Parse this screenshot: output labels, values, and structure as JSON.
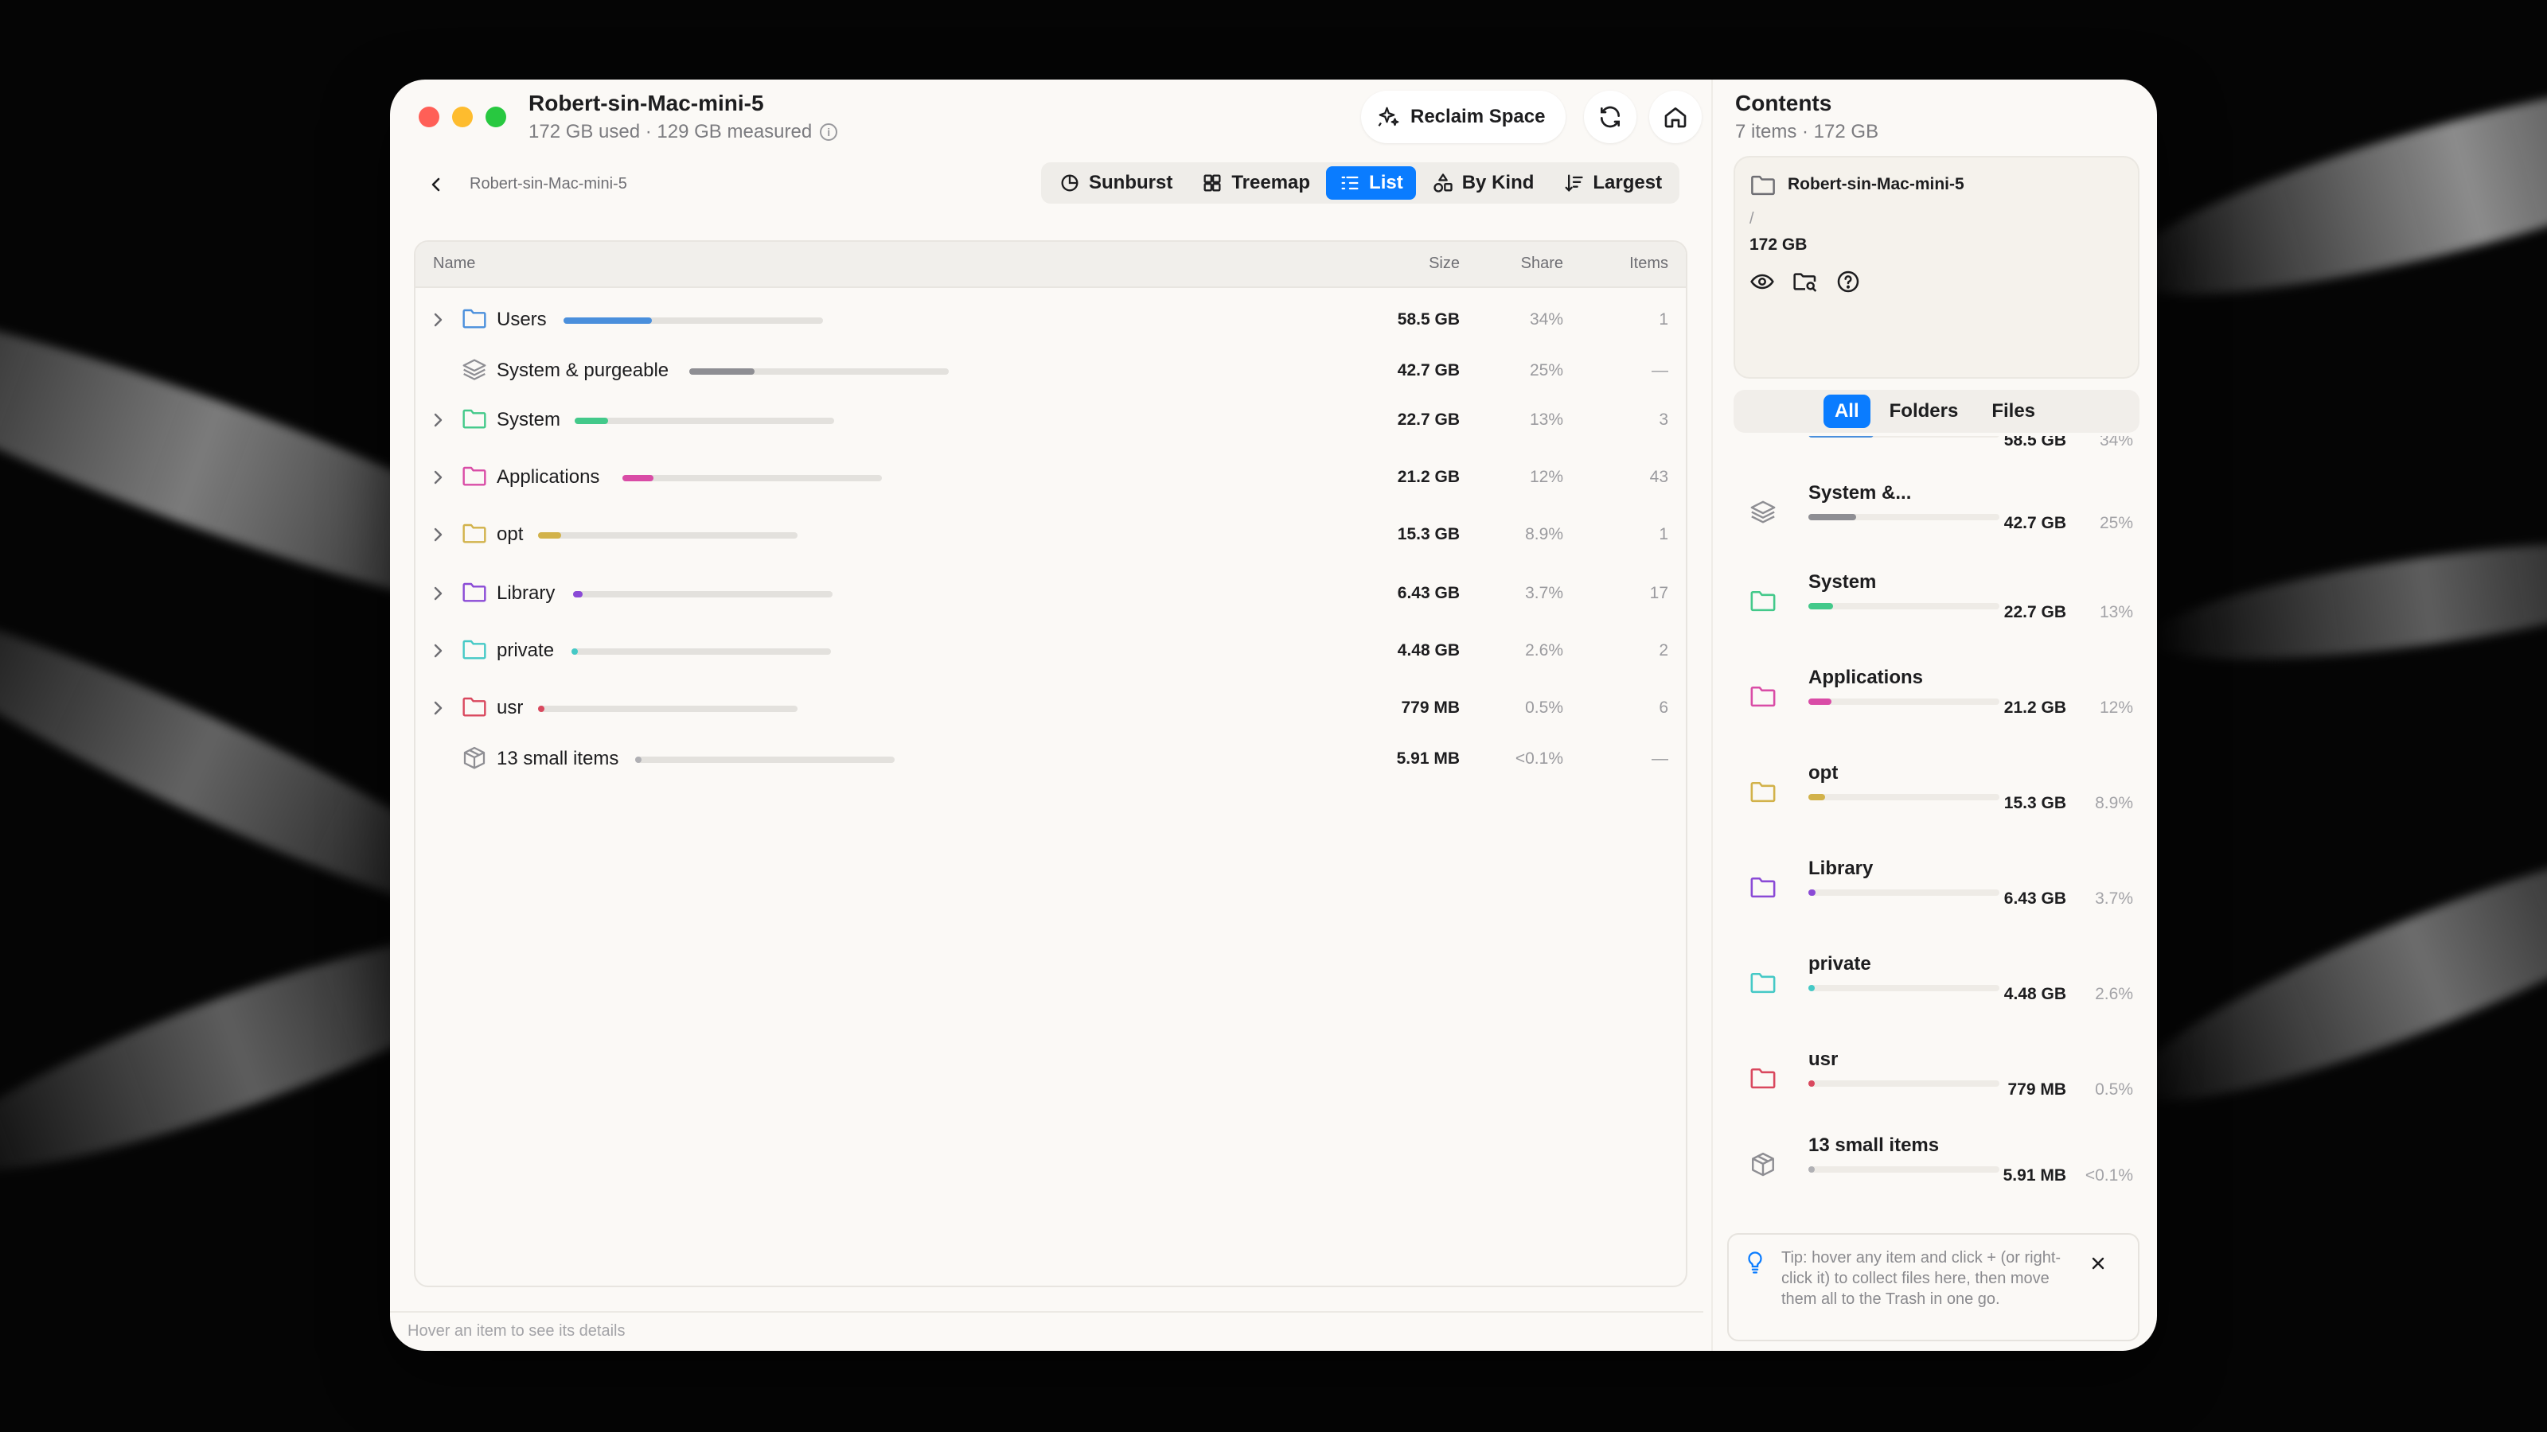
{
  "window": {
    "title": "Robert-sin-Mac-mini-5",
    "subtitle": "172 GB used · 129 GB measured",
    "reclaim_label": "Reclaim Space"
  },
  "breadcrumb": "Robert-sin-Mac-mini-5",
  "views": [
    {
      "label": "Sunburst",
      "icon": "sunburst-icon",
      "active": false
    },
    {
      "label": "Treemap",
      "icon": "treemap-icon",
      "active": false
    },
    {
      "label": "List",
      "icon": "list-icon",
      "active": true
    },
    {
      "label": "By Kind",
      "icon": "by-kind-icon",
      "active": false
    },
    {
      "label": "Largest",
      "icon": "sort-largest-icon",
      "active": false
    }
  ],
  "table": {
    "columns": {
      "name": "Name",
      "size": "Size",
      "share": "Share",
      "items": "Items"
    },
    "rows": [
      {
        "name": "Users",
        "size": "58.5 GB",
        "share": "34%",
        "items": "1",
        "expandable": true,
        "icon": "folder-icon",
        "color": "#4a8fdc",
        "fraction": 0.34
      },
      {
        "name": "System & purgeable",
        "size": "42.7 GB",
        "share": "25%",
        "items": "—",
        "expandable": false,
        "icon": "layers-icon",
        "color": "#8e8e93",
        "fraction": 0.25
      },
      {
        "name": "System",
        "size": "22.7 GB",
        "share": "13%",
        "items": "3",
        "expandable": true,
        "icon": "folder-icon",
        "color": "#43c98a",
        "fraction": 0.13
      },
      {
        "name": "Applications",
        "size": "21.2 GB",
        "share": "12%",
        "items": "43",
        "expandable": true,
        "icon": "folder-icon",
        "color": "#d94ca6",
        "fraction": 0.12
      },
      {
        "name": "opt",
        "size": "15.3 GB",
        "share": "8.9%",
        "items": "1",
        "expandable": true,
        "icon": "folder-icon",
        "color": "#d2b24a",
        "fraction": 0.089
      },
      {
        "name": "Library",
        "size": "6.43 GB",
        "share": "3.7%",
        "items": "17",
        "expandable": true,
        "icon": "folder-icon",
        "color": "#8a4ad6",
        "fraction": 0.037
      },
      {
        "name": "private",
        "size": "4.48 GB",
        "share": "2.6%",
        "items": "2",
        "expandable": true,
        "icon": "folder-icon",
        "color": "#45c9c6",
        "fraction": 0.026
      },
      {
        "name": "usr",
        "size": "779 MB",
        "share": "0.5%",
        "items": "6",
        "expandable": true,
        "icon": "folder-icon",
        "color": "#d9485e",
        "fraction": 0.005
      },
      {
        "name": "13 small items",
        "size": "5.91 MB",
        "share": "<0.1%",
        "items": "—",
        "expandable": false,
        "icon": "cube-icon",
        "color": "#b0b0b4",
        "fraction": 0.001
      }
    ]
  },
  "status": "Hover an item to see its details",
  "contents": {
    "title": "Contents",
    "subtitle": "7 items · 172 GB",
    "selected": {
      "name": "Robert-sin-Mac-mini-5",
      "path": "/",
      "size": "172 GB"
    },
    "filters": [
      {
        "label": "All",
        "active": true
      },
      {
        "label": "Folders",
        "active": false
      },
      {
        "label": "Files",
        "active": false
      }
    ],
    "partial_row": {
      "size": "58.5 GB",
      "share": "34%",
      "color": "#4a8fdc",
      "fraction": 0.34
    },
    "items": [
      {
        "name": "System &...",
        "size": "42.7 GB",
        "share": "25%",
        "icon": "layers-icon",
        "color": "#8e8e93",
        "fraction": 0.25
      },
      {
        "name": "System",
        "size": "22.7 GB",
        "share": "13%",
        "icon": "folder-icon",
        "color": "#43c98a",
        "fraction": 0.13
      },
      {
        "name": "Applications",
        "size": "21.2 GB",
        "share": "12%",
        "icon": "folder-icon",
        "color": "#d94ca6",
        "fraction": 0.12
      },
      {
        "name": "opt",
        "size": "15.3 GB",
        "share": "8.9%",
        "icon": "folder-icon",
        "color": "#d2b24a",
        "fraction": 0.089
      },
      {
        "name": "Library",
        "size": "6.43 GB",
        "share": "3.7%",
        "icon": "folder-icon",
        "color": "#8a4ad6",
        "fraction": 0.037
      },
      {
        "name": "private",
        "size": "4.48 GB",
        "share": "2.6%",
        "icon": "folder-icon",
        "color": "#45c9c6",
        "fraction": 0.026
      },
      {
        "name": "usr",
        "size": "779 MB",
        "share": "0.5%",
        "icon": "folder-icon",
        "color": "#d9485e",
        "fraction": 0.005
      },
      {
        "name": "13 small items",
        "size": "5.91 MB",
        "share": "<0.1%",
        "icon": "cube-icon",
        "color": "#b0b0b4",
        "fraction": 0.001
      }
    ]
  },
  "tip": {
    "text": "Tip: hover any item and click + (or right-click it) to collect files here, then move them all to the Trash in one go."
  },
  "colors": {
    "accent": "#0a7cff",
    "close": "#ff5f57",
    "minimize": "#febc2e",
    "zoom": "#28c840"
  }
}
